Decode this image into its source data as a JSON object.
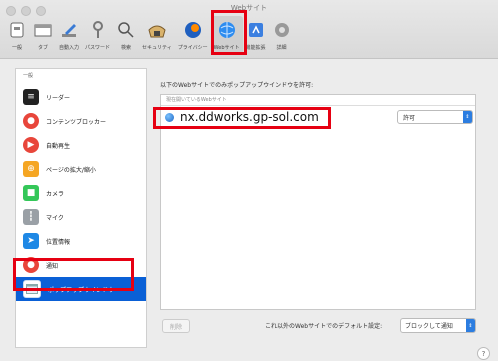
{
  "window": {
    "title": "Webサイト"
  },
  "toolbar": {
    "items": [
      {
        "label": "一般",
        "icon": "switch-icon"
      },
      {
        "label": "タブ",
        "icon": "tabs-icon"
      },
      {
        "label": "自動入力",
        "icon": "pencil-icon"
      },
      {
        "label": "パスワード",
        "icon": "key-icon"
      },
      {
        "label": "検索",
        "icon": "search-icon"
      },
      {
        "label": "セキュリティ",
        "icon": "security-icon"
      },
      {
        "label": "プライバシー",
        "icon": "privacy-icon"
      },
      {
        "label": "Webサイト",
        "icon": "globe-icon",
        "selected": true
      },
      {
        "label": "機能拡張",
        "icon": "extensions-icon"
      },
      {
        "label": "詳細",
        "icon": "gear-icon"
      }
    ]
  },
  "sidebar": {
    "header": "一般",
    "items": [
      {
        "label": "リーダー",
        "icon": "reader-icon",
        "color": "#222222"
      },
      {
        "label": "コンテンツブロッカー",
        "icon": "content-blocker-icon",
        "color": "#e8463b"
      },
      {
        "label": "自動再生",
        "icon": "autoplay-icon",
        "color": "#e8463b"
      },
      {
        "label": "ページの拡大/縮小",
        "icon": "zoom-icon",
        "color": "#f5a623"
      },
      {
        "label": "カメラ",
        "icon": "camera-icon",
        "color": "#34c759"
      },
      {
        "label": "マイク",
        "icon": "microphone-icon",
        "color": "#9aa0a6"
      },
      {
        "label": "位置情報",
        "icon": "location-icon",
        "color": "#1e88e5"
      },
      {
        "label": "通知",
        "icon": "notification-icon",
        "color": "#e8463b"
      },
      {
        "label": "ポップアップウインドウ",
        "icon": "popup-window-icon",
        "color": "#ffffff",
        "active": true
      }
    ]
  },
  "main": {
    "label": "以下のWebサイトでのみポップアップウインドウを許可:",
    "column_header": "現在開いているWebサイト",
    "rows": [
      {
        "site": "nx.ddworks.gp-sol.com",
        "setting": "許可"
      }
    ],
    "remove_button": "削除",
    "default_label": "これ以外のWebサイトでのデフォルト設定:",
    "default_value": "ブロックして通知"
  },
  "help": "?"
}
